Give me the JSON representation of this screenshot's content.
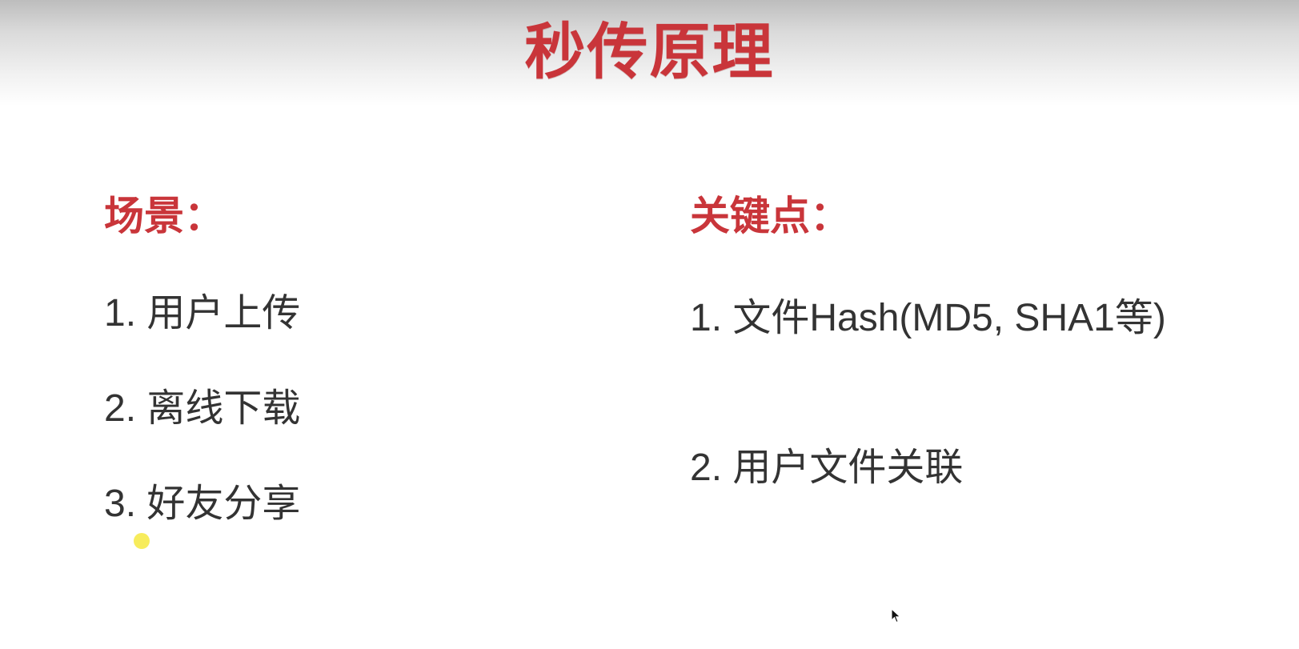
{
  "slide": {
    "title": "秒传原理",
    "title_color": "#c9353a",
    "text_color": "#333333"
  },
  "left_column": {
    "heading": "场景：",
    "items": [
      "1. 用户上传",
      "2. 离线下载",
      "3. 好友分享"
    ]
  },
  "right_column": {
    "heading": "关键点：",
    "items": [
      "1. 文件Hash(MD5, SHA1等)",
      "2. 用户文件关联"
    ]
  },
  "overlay": {
    "pointer_highlight_color": "#f6ea4a",
    "cursor_icon": "arrow-cursor-icon"
  }
}
